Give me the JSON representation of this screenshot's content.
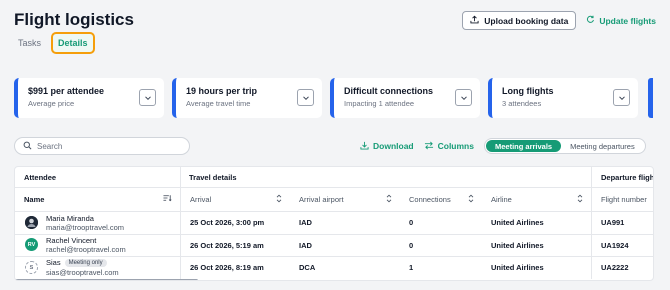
{
  "header": {
    "title": "Flight logistics",
    "upload_label": "Upload booking data",
    "update_label": "Update flights"
  },
  "tabs": [
    {
      "label": "Tasks",
      "active": false
    },
    {
      "label": "Details",
      "active": true
    }
  ],
  "cards": [
    {
      "title": "$991 per attendee",
      "subtitle": "Average price"
    },
    {
      "title": "19 hours per trip",
      "subtitle": "Average travel time"
    },
    {
      "title": "Difficult connections",
      "subtitle": "Impacting 1 attendee"
    },
    {
      "title": "Long flights",
      "subtitle": "3 attendees"
    }
  ],
  "toolbar": {
    "search_placeholder": "Search",
    "download_label": "Download",
    "columns_label": "Columns",
    "segment": {
      "active": "Meeting arrivals",
      "inactive": "Meeting departures"
    }
  },
  "table": {
    "groups": {
      "attendee": "Attendee",
      "travel": "Travel details",
      "departure": "Departure flight"
    },
    "columns": {
      "name": "Name",
      "arrival": "Arrival",
      "airport": "Arrival airport",
      "connections": "Connections",
      "airline": "Airline",
      "flight": "Flight number"
    },
    "rows": [
      {
        "name": "Maria Miranda",
        "email": "maria@trooptravel.com",
        "badge": "",
        "avatar": "",
        "arrival": "25 Oct 2026, 3:00 pm",
        "airport": "IAD",
        "connections": "0",
        "airline": "United Airlines",
        "flight": "UA991"
      },
      {
        "name": "Rachel Vincent",
        "email": "rachel@trooptravel.com",
        "badge": "",
        "avatar": "RV",
        "arrival": "26 Oct 2026, 5:19 am",
        "airport": "IAD",
        "connections": "0",
        "airline": "United Airlines",
        "flight": "UA1924"
      },
      {
        "name": "Sias",
        "email": "sias@trooptravel.com",
        "badge": "Meeting only",
        "avatar": "S",
        "arrival": "26 Oct 2026, 8:19 am",
        "airport": "DCA",
        "connections": "1",
        "airline": "United Airlines",
        "flight": "UA2222"
      }
    ]
  },
  "colors": {
    "accent": "#169b76",
    "card_edge": "#2563eb",
    "highlight": "#f59e0b"
  }
}
